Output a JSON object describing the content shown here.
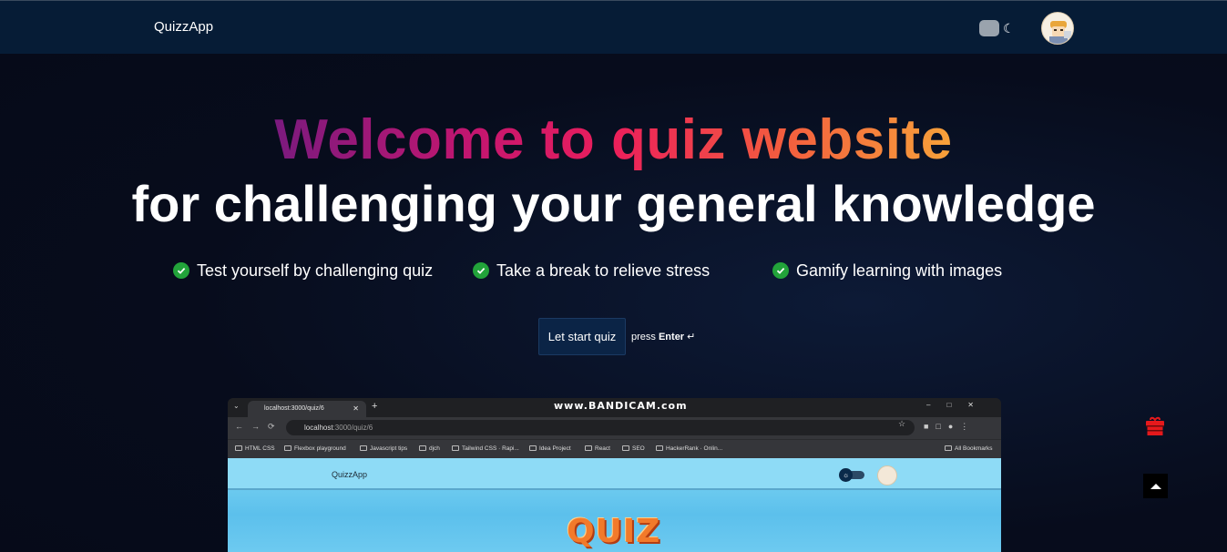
{
  "navbar": {
    "brand": "QuizzApp",
    "theme_toggle_icon": "moon-icon",
    "avatar_icon": "user-avatar"
  },
  "hero": {
    "title": "Welcome to quiz website",
    "subtitle": "for challenging your general knowledge",
    "features": [
      "Test yourself by challenging quiz",
      "Take a break to relieve stress",
      "Gamify learning with images"
    ],
    "start_button": "Let start quiz",
    "press_prefix": "press",
    "press_key": "Enter",
    "press_icon": "↵"
  },
  "preview": {
    "tab_title": "localhost:3000/quiz/6",
    "watermark": "www.BANDICAM.com",
    "url_host": "localhost",
    "url_rest": ":3000/quiz/6",
    "bookmarks": [
      "HTML CSS",
      "Flexbox playground",
      "Javascript tips",
      "djch",
      "Tailwind CSS · Rapi...",
      "Idea Project",
      "React",
      "SEO",
      "HackerRank · Onlin..."
    ],
    "all_bookmarks": "All Bookmarks",
    "page_brand": "QuizzApp",
    "page_logo": "QUIZ"
  },
  "floating": {
    "gift_icon": "gift-icon",
    "scroll_top_icon": "arrow-up-icon"
  },
  "colors": {
    "navbar_bg": "#061c36",
    "page_bg": "#070c1c",
    "check_green": "#22a33a",
    "gift_red": "#e5191c",
    "preview_sky": "#7fd6f3"
  }
}
